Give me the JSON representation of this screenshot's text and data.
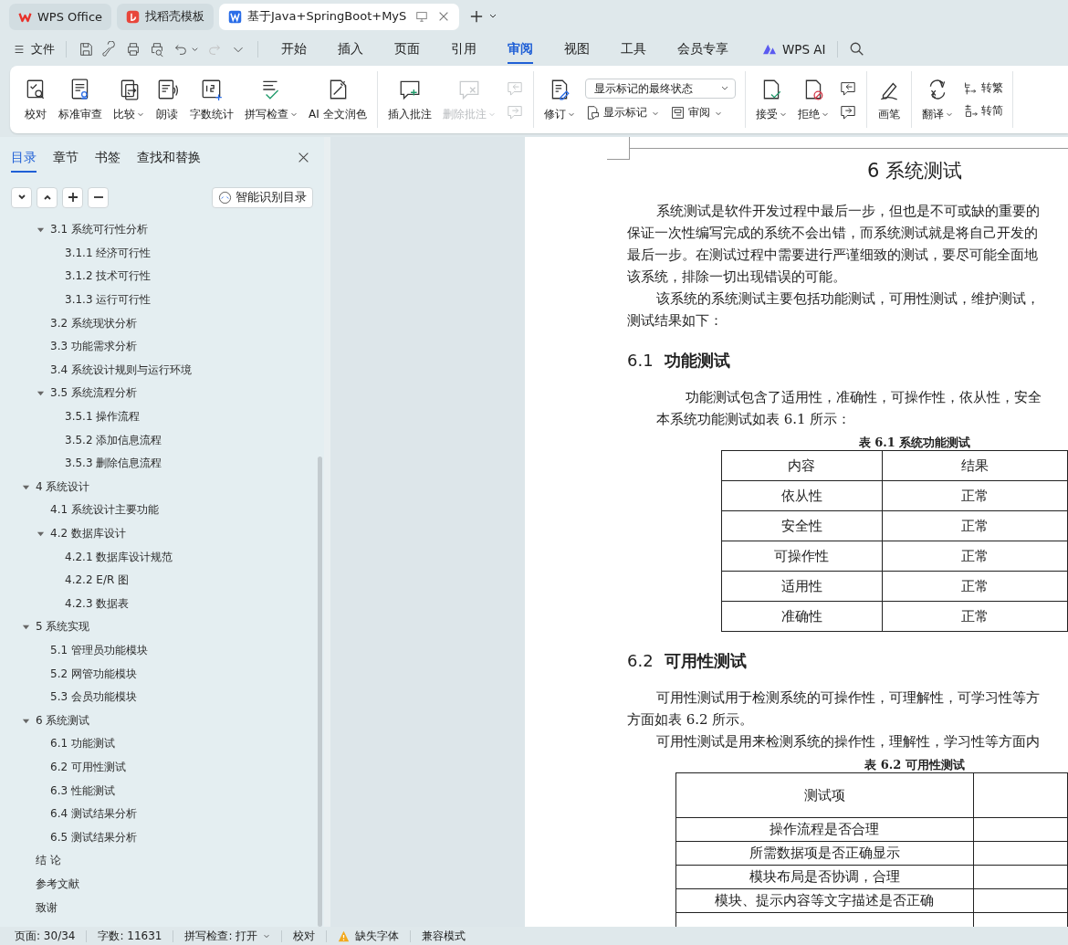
{
  "app_tabs": [
    {
      "label": "WPS Office",
      "kind": "home",
      "selected": false
    },
    {
      "label": "找稻壳模板",
      "kind": "template",
      "selected": false
    },
    {
      "label": "基于Java+SpringBoot+MyS",
      "kind": "writer",
      "selected": true
    }
  ],
  "menu": {
    "file": "文件",
    "tabs": [
      {
        "label": "开始",
        "selected": false
      },
      {
        "label": "插入",
        "selected": false
      },
      {
        "label": "页面",
        "selected": false
      },
      {
        "label": "引用",
        "selected": false
      },
      {
        "label": "审阅",
        "selected": true
      },
      {
        "label": "视图",
        "selected": false
      },
      {
        "label": "工具",
        "selected": false
      },
      {
        "label": "会员专享",
        "selected": false
      }
    ],
    "ai": "WPS AI"
  },
  "ribbon_groups": [
    [
      {
        "kind": "large",
        "label": "校对",
        "dropdown": false,
        "disabled": false
      },
      {
        "kind": "large",
        "label": "标准审查",
        "dropdown": false,
        "disabled": false
      },
      {
        "kind": "large",
        "label": "比较",
        "dropdown": true,
        "disabled": false
      },
      {
        "kind": "large",
        "label": "朗读",
        "dropdown": false,
        "disabled": false
      },
      {
        "kind": "large",
        "label": "字数统计",
        "dropdown": false,
        "disabled": false
      },
      {
        "kind": "large",
        "label": "拼写检查",
        "dropdown": true,
        "disabled": false
      },
      {
        "kind": "large",
        "label": "AI 全文润色",
        "dropdown": false,
        "disabled": false
      }
    ],
    [
      {
        "kind": "large",
        "label": "插入批注",
        "dropdown": false,
        "disabled": false
      },
      {
        "kind": "large",
        "label": "删除批注",
        "dropdown": true,
        "disabled": true
      },
      {
        "kind": "stack",
        "items": [
          {
            "disabled": true
          },
          {
            "disabled": true
          }
        ]
      }
    ],
    [
      {
        "kind": "large",
        "label": "修订",
        "dropdown": true,
        "disabled": false
      },
      {
        "kind": "display",
        "select": "显示标记的最终状态",
        "buttons": [
          {
            "label": "显示标记",
            "dropdown": true
          },
          {
            "label": "审阅",
            "dropdown": true
          }
        ]
      }
    ],
    [
      {
        "kind": "large",
        "label": "接受",
        "dropdown": true,
        "disabled": false
      },
      {
        "kind": "large",
        "label": "拒绝",
        "dropdown": true,
        "disabled": false
      },
      {
        "kind": "stack",
        "items": [
          {
            "disabled": false
          },
          {
            "disabled": false
          }
        ]
      }
    ],
    [
      {
        "kind": "large",
        "label": "画笔",
        "dropdown": false,
        "disabled": false
      }
    ],
    [
      {
        "kind": "large",
        "label": "翻译",
        "dropdown": true,
        "disabled": false
      },
      {
        "kind": "stack",
        "items": [
          {
            "label": "转繁",
            "disabled": false
          },
          {
            "label": "转简",
            "disabled": false
          }
        ]
      }
    ]
  ],
  "panel": {
    "tabs": [
      {
        "label": "目录",
        "selected": true
      },
      {
        "label": "章节",
        "selected": false
      },
      {
        "label": "书签",
        "selected": false
      },
      {
        "label": "查找和替换",
        "selected": false
      }
    ],
    "smart_button": "智能识别目录"
  },
  "toc_continued": [
    {
      "label": "3.1  系统可行性分析",
      "expanded": true,
      "children": [
        {
          "label": "3.1.1  经济可行性"
        },
        {
          "label": "3.1.2  技术可行性"
        },
        {
          "label": "3.1.3  运行可行性"
        }
      ]
    },
    {
      "label": "3.2  系统现状分析"
    },
    {
      "label": "3.3  功能需求分析"
    },
    {
      "label": "3.4  系统设计规则与运行环境"
    },
    {
      "label": "3.5 系统流程分析",
      "expanded": true,
      "children": [
        {
          "label": "3.5.1 操作流程"
        },
        {
          "label": "3.5.2 添加信息流程"
        },
        {
          "label": "3.5.3 删除信息流程"
        }
      ]
    }
  ],
  "toc": [
    {
      "label": "4  系统设计",
      "expanded": true,
      "children": [
        {
          "label": "4.1  系统设计主要功能"
        },
        {
          "label": "4.2  数据库设计",
          "expanded": true,
          "children": [
            {
              "label": "4.2.1  数据库设计规范"
            },
            {
              "label": "4.2.2 E/R 图"
            },
            {
              "label": "4.2.3  数据表"
            }
          ]
        }
      ]
    },
    {
      "label": "5  系统实现",
      "expanded": true,
      "children": [
        {
          "label": "5.1  管理员功能模块"
        },
        {
          "label": "5.2  网管功能模块"
        },
        {
          "label": "5.3  会员功能模块"
        }
      ]
    },
    {
      "label": "6  系统测试",
      "expanded": true,
      "children": [
        {
          "label": "6.1  功能测试"
        },
        {
          "label": "6.2  可用性测试"
        },
        {
          "label": "6.3  性能测试"
        },
        {
          "label": "6.4  测试结果分析"
        },
        {
          "label": "6.5  测试结果分析"
        }
      ]
    },
    {
      "label": "结  论"
    },
    {
      "label": "参考文献"
    },
    {
      "label": "致谢"
    }
  ],
  "document": {
    "title": "6  系统测试",
    "blocks": [
      {
        "kind": "indented",
        "text": "系统测试是软件开发过程中最后一步，但也是不可或缺的重要的"
      },
      {
        "kind": "plain",
        "text": "保证一次性编写完成的系统不会出错，而系统测试就是将自己开发的"
      },
      {
        "kind": "plain",
        "text": "最后一步。在测试过程中需要进行严谨细致的测试，要尽可能全面地"
      },
      {
        "kind": "plain",
        "text": "该系统，排除一切出现错误的可能。"
      },
      {
        "kind": "indented",
        "text": "该系统的系统测试主要包括功能测试，可用性测试，维护测试，"
      },
      {
        "kind": "plain",
        "text": "测试结果如下："
      },
      {
        "kind": "heading",
        "number": "6.1",
        "text": "功能测试"
      },
      {
        "kind": "deep",
        "text": "功能测试包含了适用性，准确性，可操作性，依从性，安全"
      },
      {
        "kind": "indented",
        "text": "本系统功能测试如表 6.1 所示："
      },
      {
        "kind": "caption",
        "text": "表 6.1   系统功能测试"
      },
      {
        "kind": "table",
        "columns": [
          "内容",
          "结果"
        ],
        "rows": [
          [
            "依从性",
            "正常"
          ],
          [
            "安全性",
            "正常"
          ],
          [
            "可操作性",
            "正常"
          ],
          [
            "适用性",
            "正常"
          ],
          [
            "准确性",
            "正常"
          ]
        ]
      },
      {
        "kind": "heading",
        "number": "6.2",
        "text": "可用性测试"
      },
      {
        "kind": "indented",
        "text": "可用性测试用于检测系统的可操作性，可理解性，可学习性等方"
      },
      {
        "kind": "plain",
        "text": "方面如表 6.2 所示。"
      },
      {
        "kind": "indented",
        "text": "可用性测试是用来检测系统的操作性，理解性，学习性等方面内"
      },
      {
        "kind": "caption",
        "text": "表 6.2 可用性测试"
      },
      {
        "kind": "table",
        "columns": [
          "测试项"
        ],
        "rows": [
          [
            "操作流程是否合理"
          ],
          [
            "所需数据项是否正确显示"
          ],
          [
            "模块布局是否协调，合理"
          ],
          [
            "模块、提示内容等文字描述是否正确"
          ]
        ]
      }
    ]
  },
  "status_bar": [
    {
      "kind": "text",
      "text": "页面: 30/34"
    },
    {
      "kind": "text",
      "text": "字数: 11631"
    },
    {
      "kind": "dropdown",
      "text": "拼写检查: 打开"
    },
    {
      "kind": "text",
      "text": "校对"
    },
    {
      "kind": "warning",
      "text": "缺失字体"
    },
    {
      "kind": "text",
      "text": "兼容模式"
    }
  ]
}
